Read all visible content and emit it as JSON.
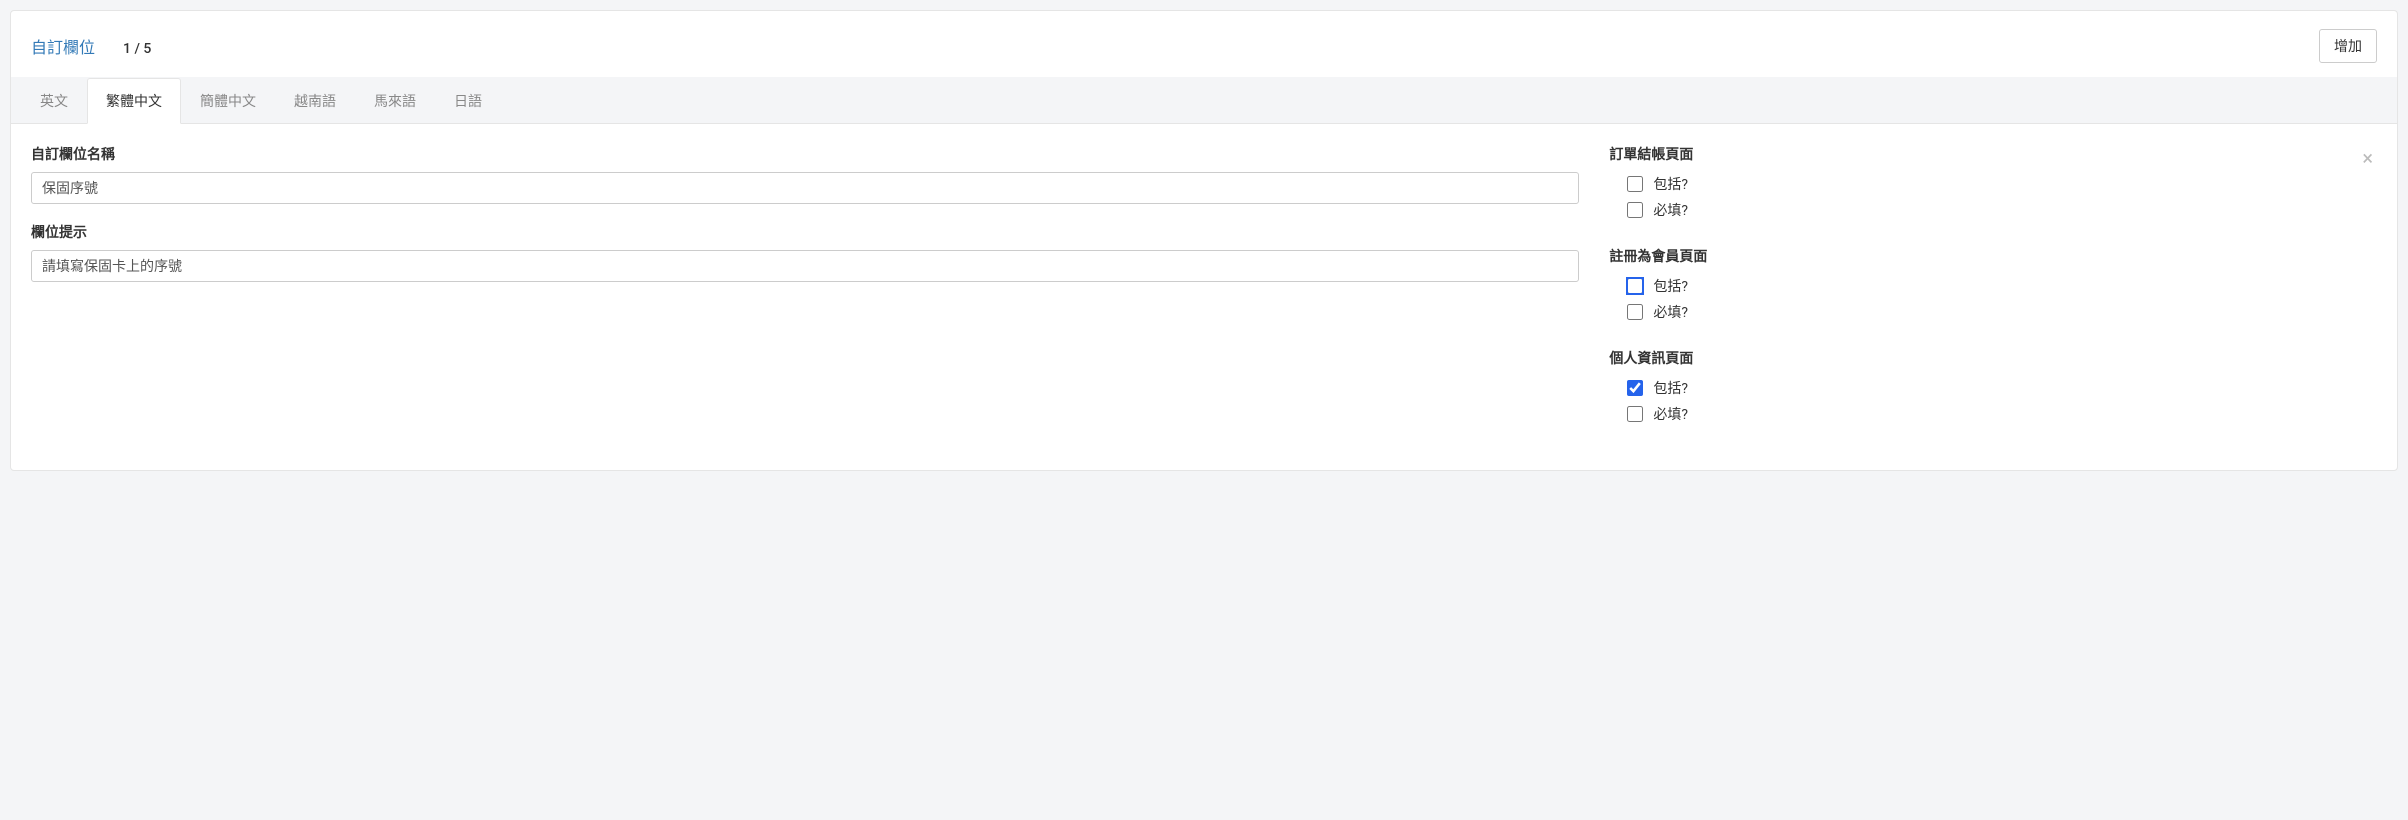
{
  "header": {
    "title": "自訂欄位",
    "counter": "1 / 5",
    "add_button": "增加"
  },
  "tabs": [
    {
      "label": "英文"
    },
    {
      "label": "繁體中文"
    },
    {
      "label": "簡體中文"
    },
    {
      "label": "越南語"
    },
    {
      "label": "馬來語"
    },
    {
      "label": "日語"
    }
  ],
  "form": {
    "name_label": "自訂欄位名稱",
    "name_value": "保固序號",
    "hint_label": "欄位提示",
    "hint_value": "請填寫保固卡上的序號"
  },
  "sections": [
    {
      "title": "訂單結帳頁面",
      "include_label": "包括?",
      "include_checked": false,
      "include_highlight": false,
      "required_label": "必填?",
      "required_checked": false
    },
    {
      "title": "註冊為會員頁面",
      "include_label": "包括?",
      "include_checked": false,
      "include_highlight": true,
      "required_label": "必填?",
      "required_checked": false
    },
    {
      "title": "個人資訊頁面",
      "include_label": "包括?",
      "include_checked": true,
      "include_highlight": false,
      "required_label": "必填?",
      "required_checked": false
    }
  ]
}
